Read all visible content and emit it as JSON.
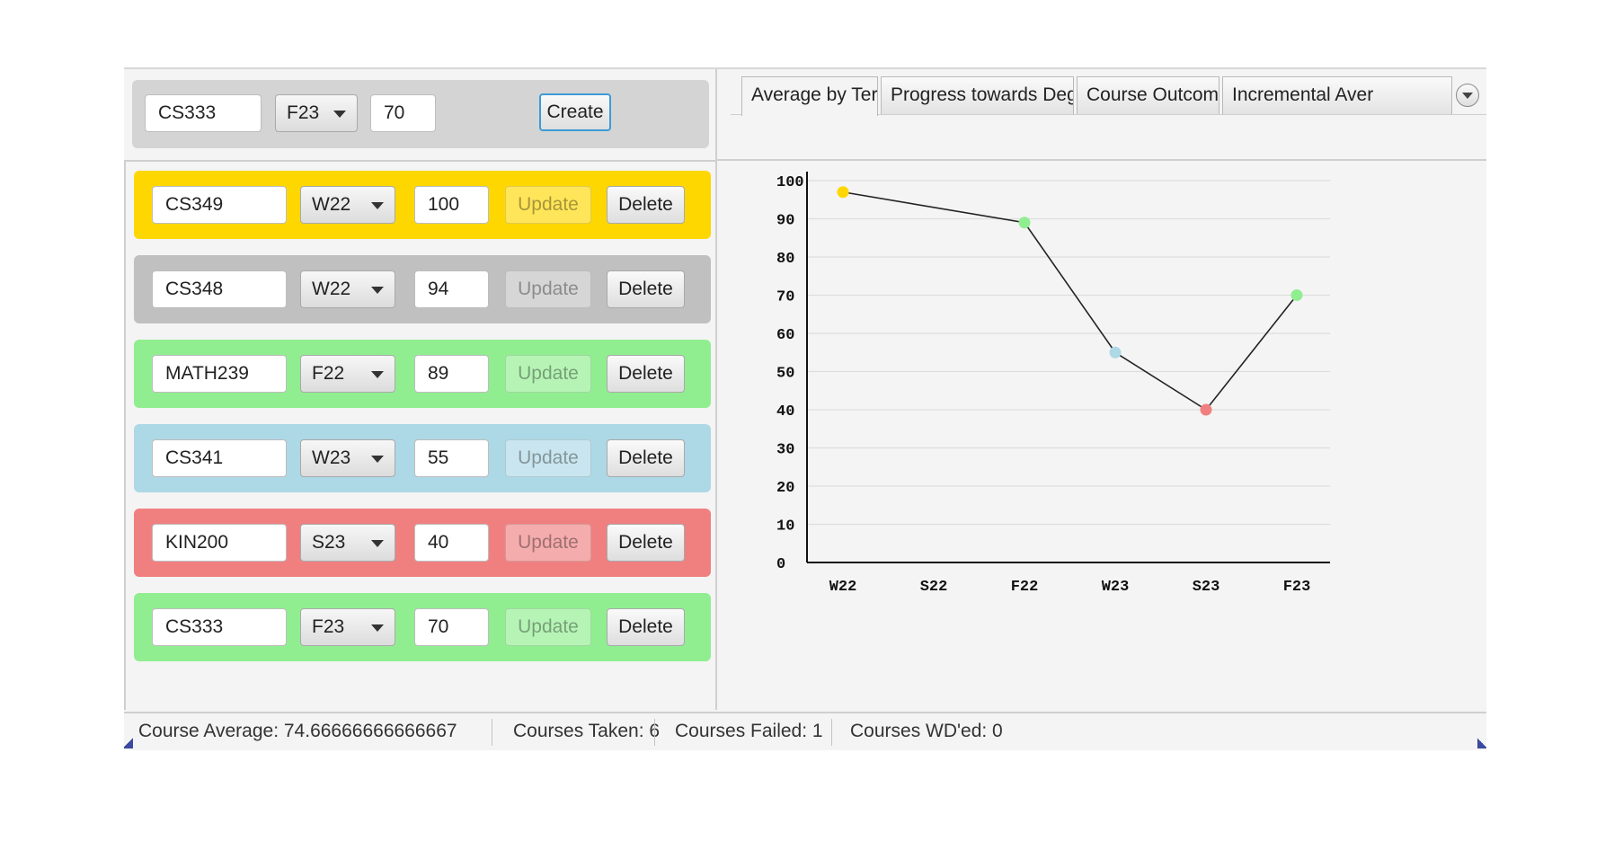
{
  "create_row": {
    "course": "CS333",
    "term": "F23",
    "grade": "70",
    "create_label": "Create"
  },
  "courses": [
    {
      "course": "CS349",
      "term": "W22",
      "grade": "100",
      "color": "#ffd700"
    },
    {
      "course": "CS348",
      "term": "W22",
      "grade": "94",
      "color": "#c0c0c0"
    },
    {
      "course": "MATH239",
      "term": "F22",
      "grade": "89",
      "color": "#90ee90"
    },
    {
      "course": "CS341",
      "term": "W23",
      "grade": "55",
      "color": "#add8e6"
    },
    {
      "course": "KIN200",
      "term": "S23",
      "grade": "40",
      "color": "#f08080"
    },
    {
      "course": "CS333",
      "term": "F23",
      "grade": "70",
      "color": "#90ee90"
    }
  ],
  "buttons": {
    "update_label": "Update",
    "delete_label": "Delete"
  },
  "tabs": [
    "Average by Term",
    "Progress towards Degree",
    "Course Outcomes",
    "Incremental Aver"
  ],
  "active_tab": 0,
  "chart_data": {
    "type": "line",
    "categories": [
      "W22",
      "S22",
      "F22",
      "W23",
      "S23",
      "F23"
    ],
    "points": [
      {
        "x": "W22",
        "y": 97,
        "color": "#ffd700"
      },
      {
        "x": "F22",
        "y": 89,
        "color": "#90ee90"
      },
      {
        "x": "W23",
        "y": 55,
        "color": "#add8e6"
      },
      {
        "x": "S23",
        "y": 40,
        "color": "#f08080"
      },
      {
        "x": "F23",
        "y": 70,
        "color": "#90ee90"
      }
    ],
    "yticks": [
      "0",
      "10",
      "20",
      "30",
      "40",
      "50",
      "60",
      "70",
      "80",
      "90",
      "100"
    ],
    "ylim": [
      0,
      100
    ],
    "grid": true,
    "line_color": "#222222"
  },
  "status": {
    "average": "Course Average: 74.66666666666667",
    "taken": "Courses Taken: 6",
    "failed": "Courses Failed: 1",
    "wd": "Courses WD'ed: 0"
  }
}
